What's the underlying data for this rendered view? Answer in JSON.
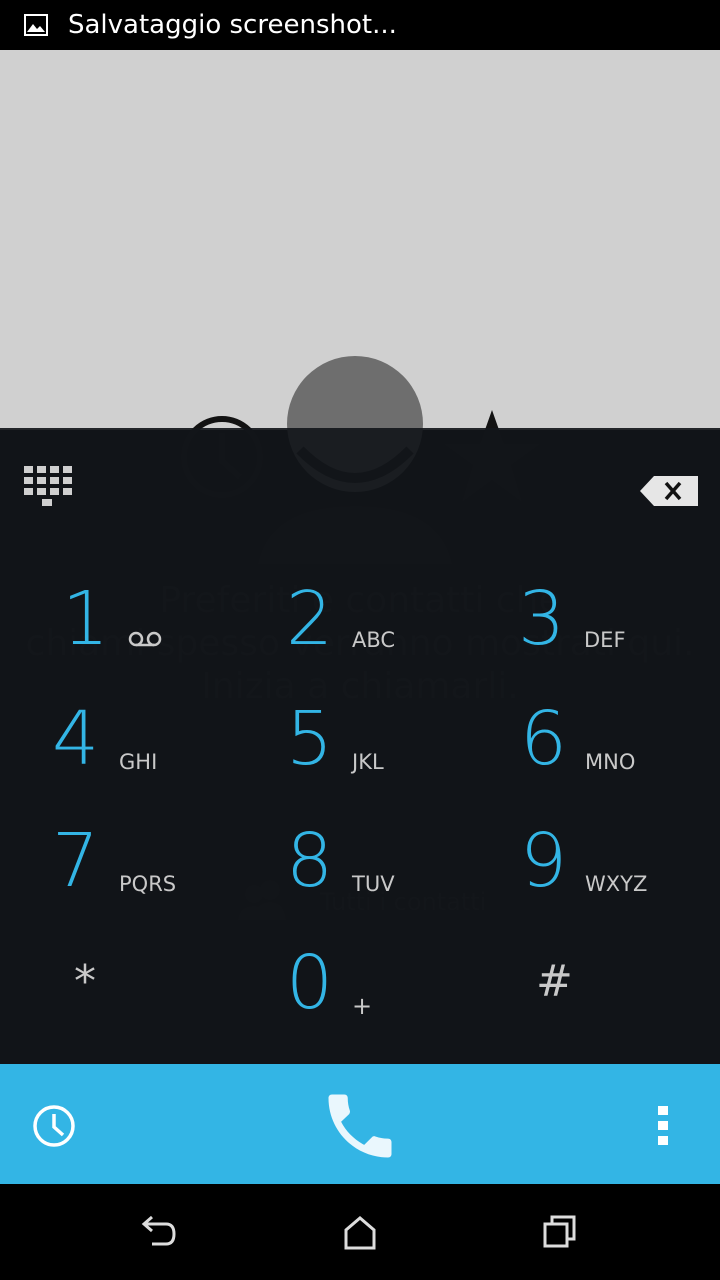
{
  "status_bar": {
    "notification_text": "Salvataggio screenshot..."
  },
  "empty_state": {
    "line1": "Preferiti e contatti che",
    "line2": "chiami spesso verranno mostrati qui.",
    "line3": "Inizia a chiamarli.",
    "all_contacts": "Tutti i contatti"
  },
  "keys": [
    {
      "digit": "1",
      "letters": ""
    },
    {
      "digit": "2",
      "letters": "ABC"
    },
    {
      "digit": "3",
      "letters": "DEF"
    },
    {
      "digit": "4",
      "letters": "GHI"
    },
    {
      "digit": "5",
      "letters": "JKL"
    },
    {
      "digit": "6",
      "letters": "MNO"
    },
    {
      "digit": "7",
      "letters": "PQRS"
    },
    {
      "digit": "8",
      "letters": "TUV"
    },
    {
      "digit": "9",
      "letters": "WXYZ"
    },
    {
      "digit": "*",
      "letters": ""
    },
    {
      "digit": "0",
      "letters": "+"
    },
    {
      "digit": "#",
      "letters": ""
    }
  ],
  "icons": {
    "notification": "image-icon",
    "dialpad_toggle": "dialpad-grid-icon",
    "backspace": "backspace-icon",
    "voicemail": "voicemail-icon",
    "call_history": "clock-icon",
    "call": "phone-icon",
    "overflow": "more-vert-icon",
    "nav_back": "back-icon",
    "nav_home": "home-icon",
    "nav_recents": "recents-icon"
  },
  "colors": {
    "accent": "#33b5e5",
    "dialpad_bg": "#12161a",
    "action_bar": "#33b5e5"
  }
}
